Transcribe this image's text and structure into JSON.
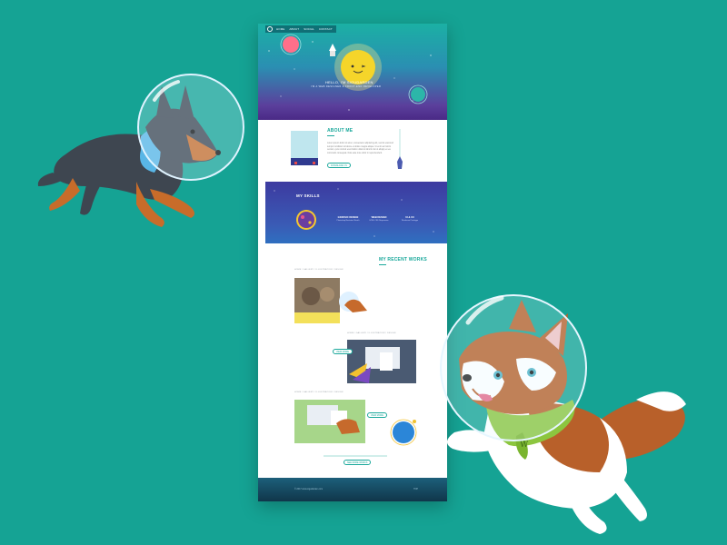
{
  "colors": {
    "background": "#15a394",
    "accent": "#1aa89b",
    "hero_top": "#1bb0a4",
    "hero_bottom": "#4a2a86",
    "skills_bg": "#3d3aa0"
  },
  "nav": {
    "items": [
      "HOME",
      "ABOUT",
      "SOCIAL",
      "CONTACT"
    ]
  },
  "hero": {
    "title": "HELLO, I'M SIGUDARDEN",
    "subtitle": "I'M A WEB DESIGNER & FRONT-END DEVELOPER"
  },
  "about": {
    "title": "ABOUT ME",
    "text": "Lorem ipsum dolor sit amet, consectetur adipiscing elit, sed do eiusmod tempor incididunt ut labore et dolore magna aliqua. Ut enim ad minim veniam, quis nostrud exercitation ullamco laboris nisi ut aliquip ex ea commodo consequat. Duis aute irure dolor in reprehenderit.",
    "button": "DOWNLOAD CV"
  },
  "skills": {
    "title": "MY SKILLS",
    "items": [
      {
        "heading": "GRAPHIC DESIGN",
        "desc": "Photoshop Illustrator Sketch"
      },
      {
        "heading": "WEB DESIGN",
        "desc": "HTML CSS Responsive"
      },
      {
        "heading": "UI & UX",
        "desc": "Wireframe Prototype"
      }
    ]
  },
  "works": {
    "title": "MY RECENT WORKS",
    "items": [
      {
        "crumb": "HOME / GALLERY / ILLUSTRATION / DESIGN"
      },
      {
        "crumb": "HOME / GALLERY / ILLUSTRATION / DESIGN",
        "button": "VIEW MORE"
      },
      {
        "crumb": "HOME / GALLERY / ILLUSTRATION / DESIGN",
        "button": "VIEW MORE"
      }
    ],
    "more_button": "SEE MORE WORKS"
  },
  "footer": {
    "copyright": "© 2017 www.sigudarden.com",
    "top_link": "TOP"
  },
  "characters": {
    "left": "doberman-astronaut",
    "right": "husky-astronaut"
  }
}
